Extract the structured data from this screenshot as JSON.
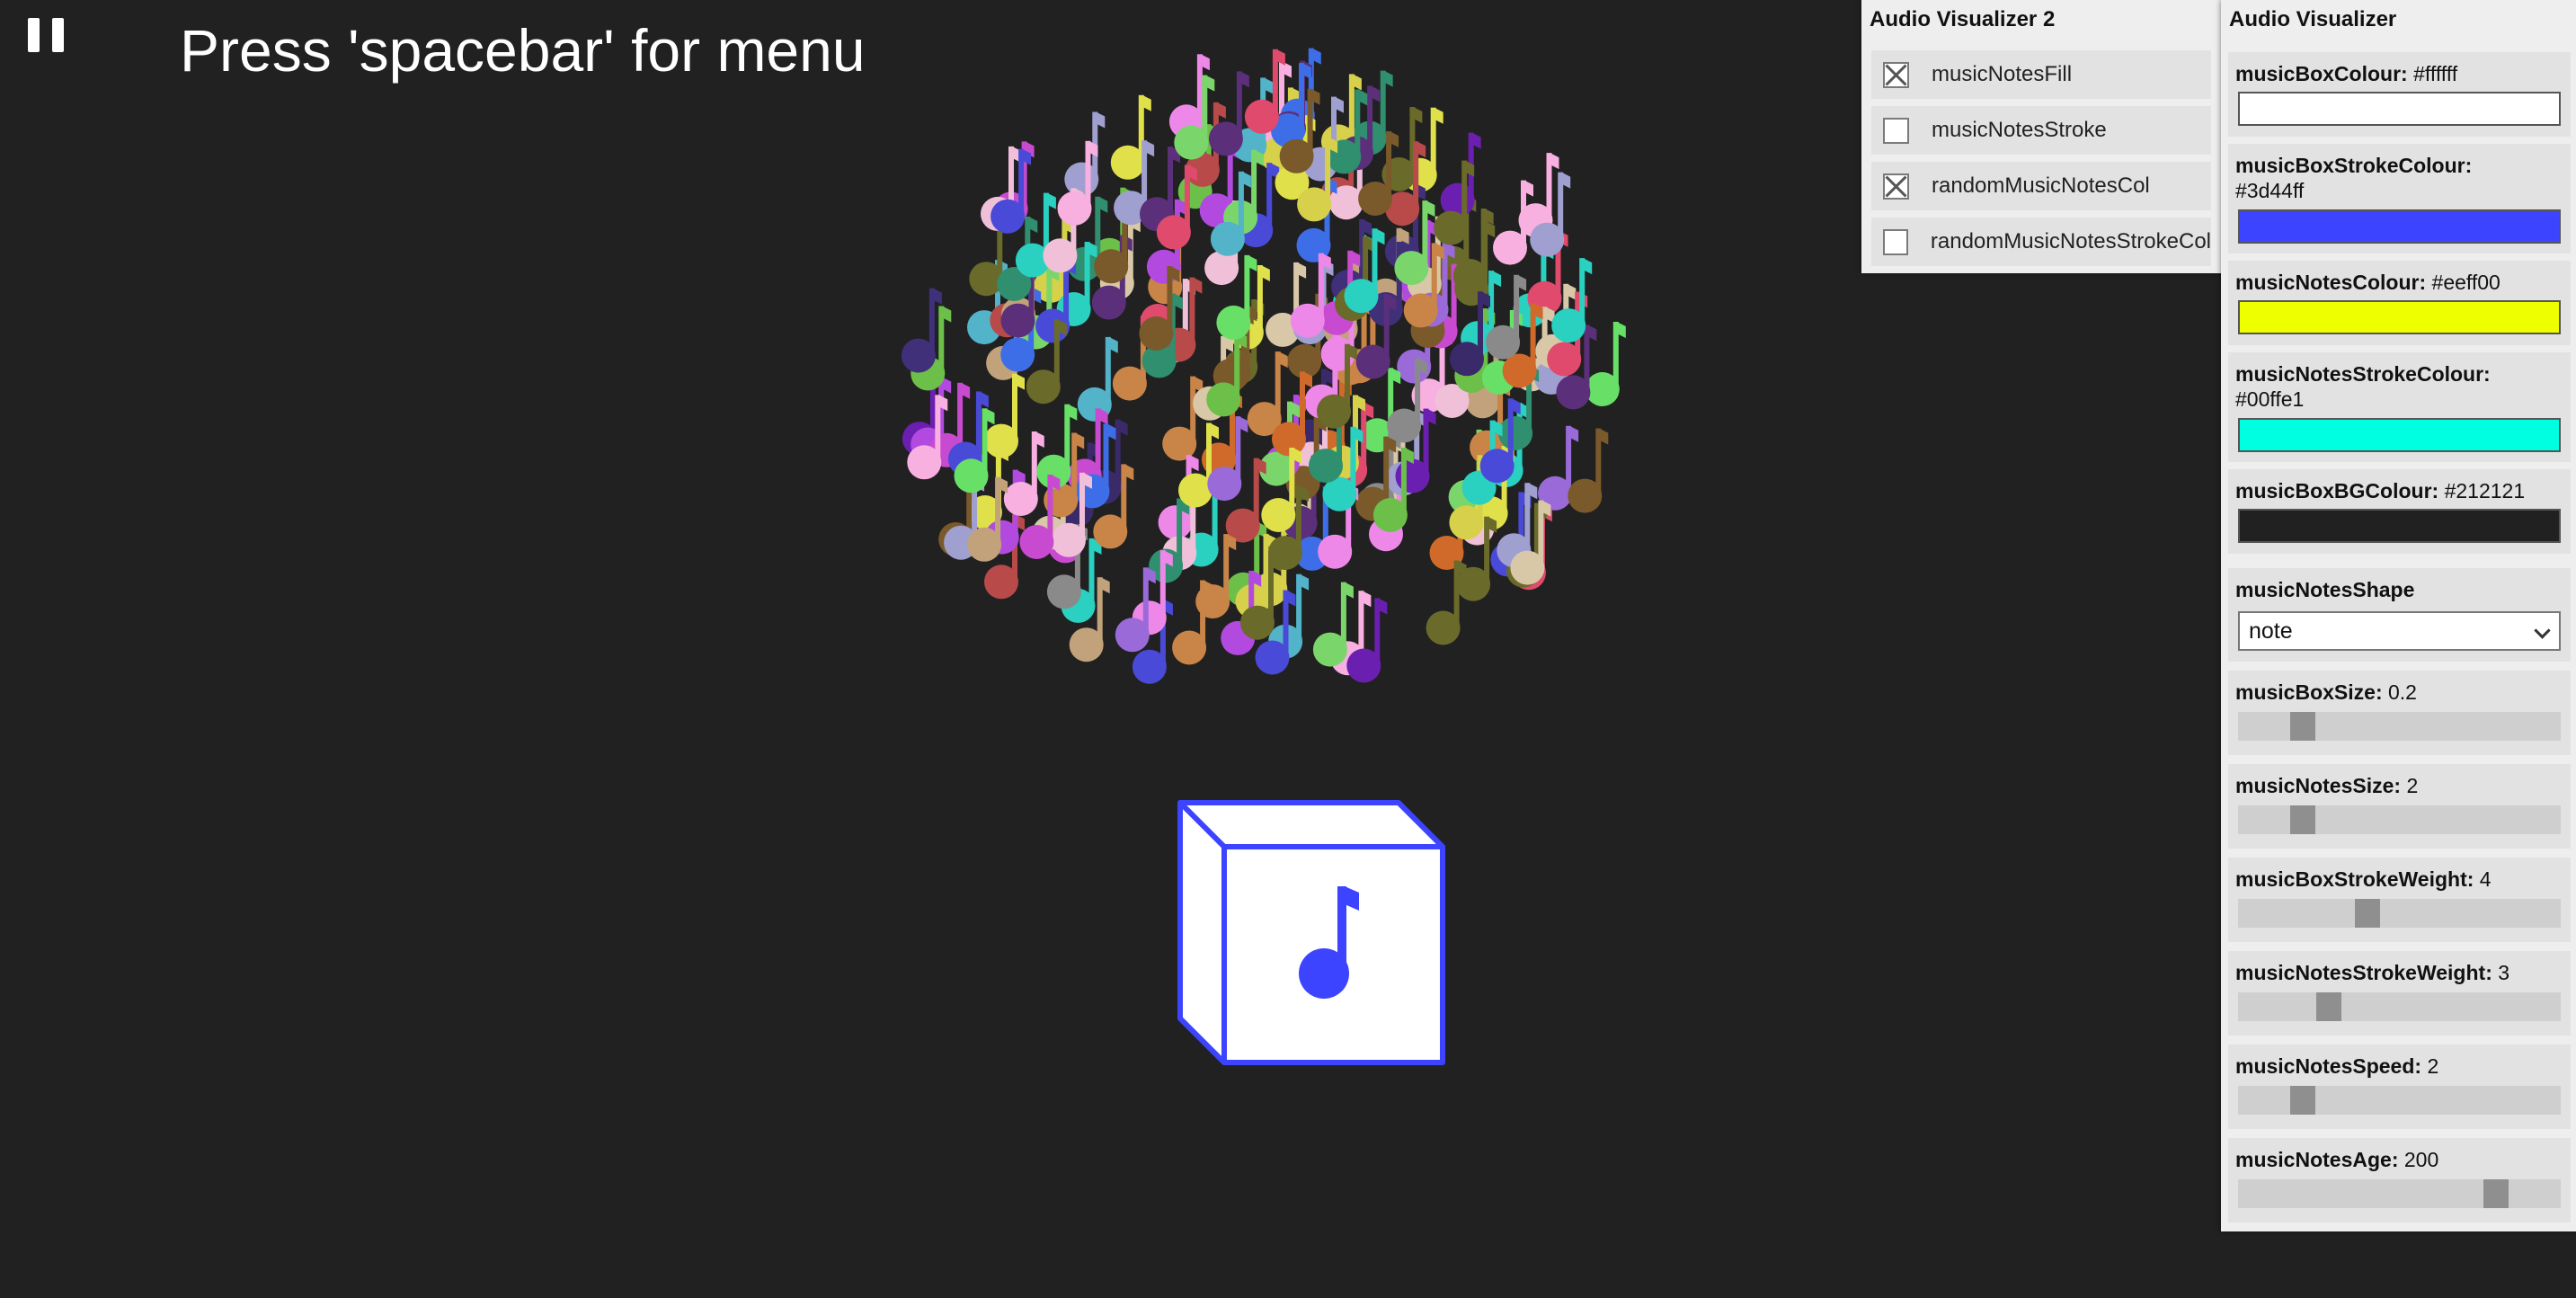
{
  "header": {
    "title": "Press 'spacebar' for menu"
  },
  "music_box": {
    "fill": "#ffffff",
    "stroke": "#3d44ff",
    "note_color": "#3d44ff"
  },
  "panel2": {
    "title": "Audio Visualizer 2",
    "checkboxes": [
      {
        "label": "musicNotesFill",
        "checked": true
      },
      {
        "label": "musicNotesStroke",
        "checked": false
      },
      {
        "label": "randomMusicNotesCol",
        "checked": true
      },
      {
        "label": "randomMusicNotesStrokeCol",
        "checked": false
      }
    ]
  },
  "panel1": {
    "title": "Audio Visualizer",
    "colors": [
      {
        "name": "musicBoxColour:",
        "value": "#ffffff"
      },
      {
        "name": "musicBoxStrokeColour:",
        "value": "#3d44ff"
      },
      {
        "name": "musicNotesColour:",
        "value": "#eeff00"
      },
      {
        "name": "musicNotesStrokeColour:",
        "value": "#00ffe1"
      },
      {
        "name": "musicBoxBGColour:",
        "value": "#212121"
      }
    ],
    "shape": {
      "name": "musicNotesShape",
      "value": "note"
    },
    "sliders": [
      {
        "name": "musicBoxSize:",
        "value": "0.2",
        "fraction": 0.2
      },
      {
        "name": "musicNotesSize:",
        "value": "2",
        "fraction": 0.2
      },
      {
        "name": "musicBoxStrokeWeight:",
        "value": "4",
        "fraction": 0.4
      },
      {
        "name": "musicNotesStrokeWeight:",
        "value": "3",
        "fraction": 0.28
      },
      {
        "name": "musicNotesSpeed:",
        "value": "2",
        "fraction": 0.2
      },
      {
        "name": "musicNotesAge:",
        "value": "200",
        "fraction": 0.8
      }
    ]
  },
  "note_palette": [
    "#6cc04a",
    "#52b3c9",
    "#c98448",
    "#c2a27a",
    "#b24ae0",
    "#3d6ee8",
    "#e04a6c",
    "#7ad66a",
    "#4a4ad8",
    "#5b2f7a",
    "#8a8a8a",
    "#e0e04a",
    "#ee88e8",
    "#6b1fb0",
    "#2f8f6f",
    "#d6d04a",
    "#b84a4a",
    "#f0c0d8",
    "#7a5a2a",
    "#a0a0d0",
    "#3a2a6a",
    "#d8c8a8",
    "#2ad0c0",
    "#c84ad0",
    "#6a6a2a",
    "#f7b0e0",
    "#40307a",
    "#d06a2a",
    "#68e068",
    "#9a6ad8"
  ]
}
